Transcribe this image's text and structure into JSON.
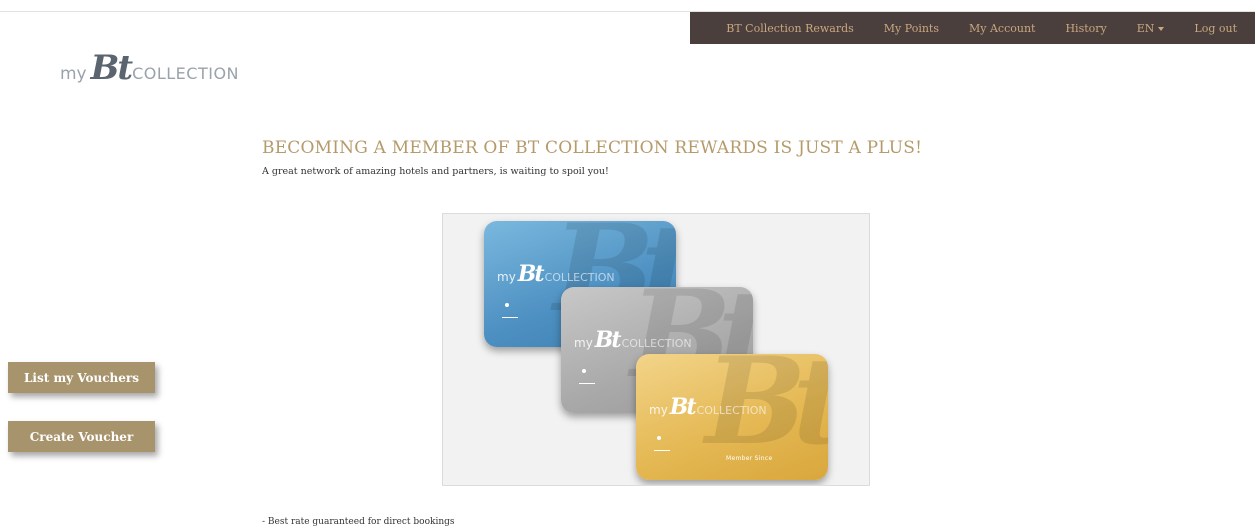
{
  "nav": {
    "items": [
      "BT Collection Rewards",
      "My Points",
      "My Account",
      "History"
    ],
    "language": "EN",
    "logout": "Log out"
  },
  "logo": {
    "my": "my",
    "bt": "Bt",
    "collection": "COLLECTION"
  },
  "main": {
    "headline": "BECOMING A MEMBER OF BT COLLECTION REWARDS IS JUST A PLUS!",
    "subline": "A great network of amazing hotels and partners, is waiting to spoil you!",
    "cards": [
      {
        "color": "#4c8fc1",
        "my": "my",
        "bt": "Bt",
        "collection": "COLLECTION",
        "watermark": "Bt"
      },
      {
        "color": "#a9a9a9",
        "my": "my",
        "bt": "Bt",
        "collection": "COLLECTION",
        "watermark": "Bt"
      },
      {
        "color": "#e5b955",
        "my": "my",
        "bt": "Bt",
        "collection": "COLLECTION",
        "watermark": "Bt",
        "member_label": "Member Since"
      }
    ],
    "bullets": [
      "- Best rate guaranteed for direct bookings"
    ]
  },
  "sidebar": {
    "list_vouchers": "List my Vouchers",
    "create_voucher": "Create Voucher"
  },
  "colors": {
    "navbar_bg": "#4a3f3d",
    "nav_text": "#c9a77f",
    "accent_gold": "#b59a6a",
    "button_bg": "#a8946c"
  }
}
